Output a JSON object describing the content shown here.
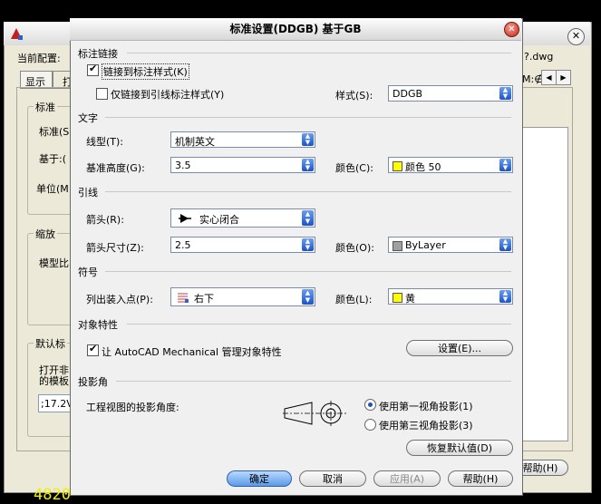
{
  "background_window": {
    "current_config_label": "当前配置:",
    "filename_suffix": "?.dwg",
    "tabs": [
      "显示",
      "打"
    ],
    "scroll_fragment": "M:∉",
    "groups": {
      "standard": {
        "legend": "标准",
        "rows": [
          "标准(S",
          "基于:(",
          "单位(M"
        ]
      },
      "scale": {
        "legend": "缩放",
        "rows": [
          "模型比"
        ]
      },
      "default": {
        "legend": "默认标",
        "rows": [
          "打开非",
          "的模板"
        ],
        "field_value": ";17.2V"
      }
    },
    "help_button": "帮助(H)",
    "bottom_text": "4820"
  },
  "dialog": {
    "title": "标准设置(DDGB) 基于GB",
    "sections": {
      "standard_link": {
        "title": "标注链接",
        "link_style_label": "链接到标注样式(K)",
        "link_style_checked": true,
        "leader_only_label": "仅链接到引线标注样式(Y)",
        "leader_only_checked": false,
        "style_label": "样式(S):",
        "style_value": "DDGB"
      },
      "text": {
        "title": "文字",
        "font_label": "线型(T):",
        "font_value": "机制英文",
        "height_label": "基准高度(G):",
        "height_value": "3.5",
        "color_label": "颜色(C):",
        "color_value": "颜色 50",
        "color_swatch": "#ffff00"
      },
      "leader": {
        "title": "引线",
        "arrow_label": "箭头(R):",
        "arrow_value": "实心闭合",
        "arrow_size_label": "箭头尺寸(Z):",
        "arrow_size_value": "2.5",
        "color_label": "颜色(O):",
        "color_value": "ByLayer",
        "color_swatch": "#a0a0a0"
      },
      "symbol": {
        "title": "符号",
        "insert_label": "列出装入点(P):",
        "insert_value": "右下",
        "color_label": "颜色(L):",
        "color_value": "黄",
        "color_swatch": "#ffff00"
      },
      "object_props": {
        "title": "对象特性",
        "manage_label": "让 AutoCAD Mechanical 管理对象特性",
        "manage_checked": true,
        "settings_button": "设置(E)..."
      },
      "projection": {
        "title": "投影角",
        "angle_label": "工程视图的投影角度:",
        "first_angle_label": "使用第一视角投影(1)",
        "third_angle_label": "使用第三视角投影(3)",
        "selected": "first"
      }
    },
    "restore_defaults_button": "恢复默认值(D)",
    "footer": {
      "ok": "确定",
      "cancel": "取消",
      "apply": "应用(A)",
      "help": "帮助(H)"
    }
  }
}
